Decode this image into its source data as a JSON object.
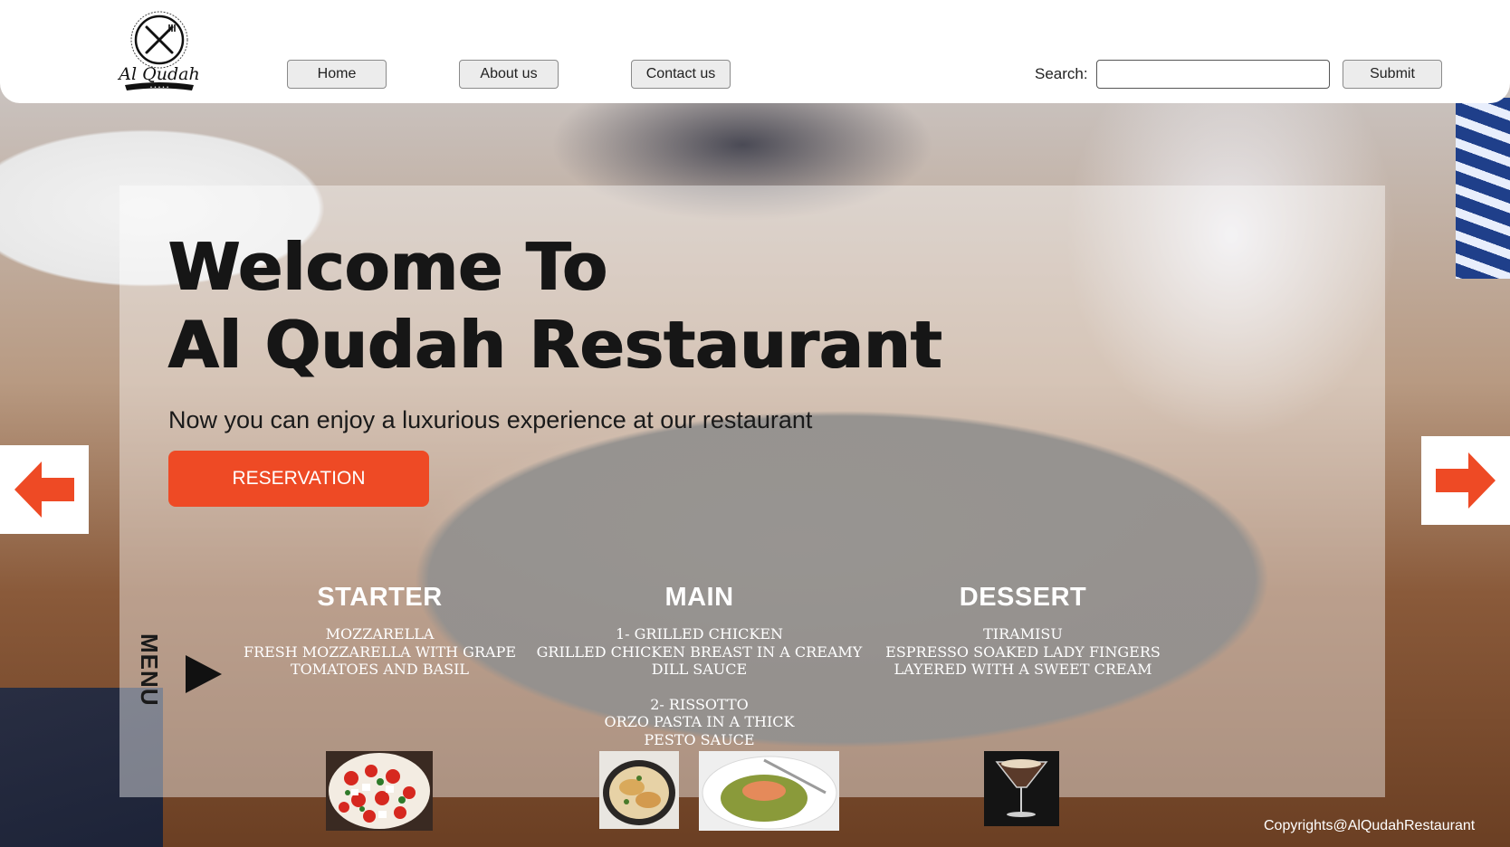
{
  "header": {
    "logo_alt": "Al Qudah",
    "nav": [
      {
        "label": "Home"
      },
      {
        "label": "About us"
      },
      {
        "label": "Contact us"
      }
    ],
    "search": {
      "label": "Search:",
      "placeholder": "",
      "value": ""
    },
    "submit_label": "Submit"
  },
  "hero": {
    "title_line1": "Welcome To",
    "title_line2": "Al Qudah Restaurant",
    "subtitle": "Now you can enjoy a luxurious experience at our restaurant",
    "reservation_label": "RESERVATION"
  },
  "menu": {
    "side_label": "MENU",
    "columns": [
      {
        "heading": "STARTER",
        "items": [
          "MOZZARELLA\nFRESH MOZZARELLA WITH GRAPE\nTOMATOES AND BASIL"
        ]
      },
      {
        "heading": "MAIN",
        "items": [
          "1- GRILLED CHICKEN\nGRILLED CHICKEN BREAST IN A CREAMY\nDILL SAUCE",
          "2- RISSOTTO\nORZO PASTA IN A THICK\nPESTO SAUCE"
        ]
      },
      {
        "heading": "DESSERT",
        "items": [
          "TIRAMISU\nESPRESSO SOAKED LADY FINGERS\nLAYERED WITH A SWEET CREAM"
        ]
      }
    ]
  },
  "footer": {
    "copyright": "Copyrights@AlQudahRestaurant"
  },
  "colors": {
    "accent": "#ee4a25",
    "header_bg": "#ffffff",
    "text_dark": "#161616"
  },
  "icons": {
    "prev": "arrow-left-icon",
    "next": "arrow-right-icon",
    "menu_toggle": "play-triangle-icon",
    "logo": "fork-knife-logo"
  }
}
